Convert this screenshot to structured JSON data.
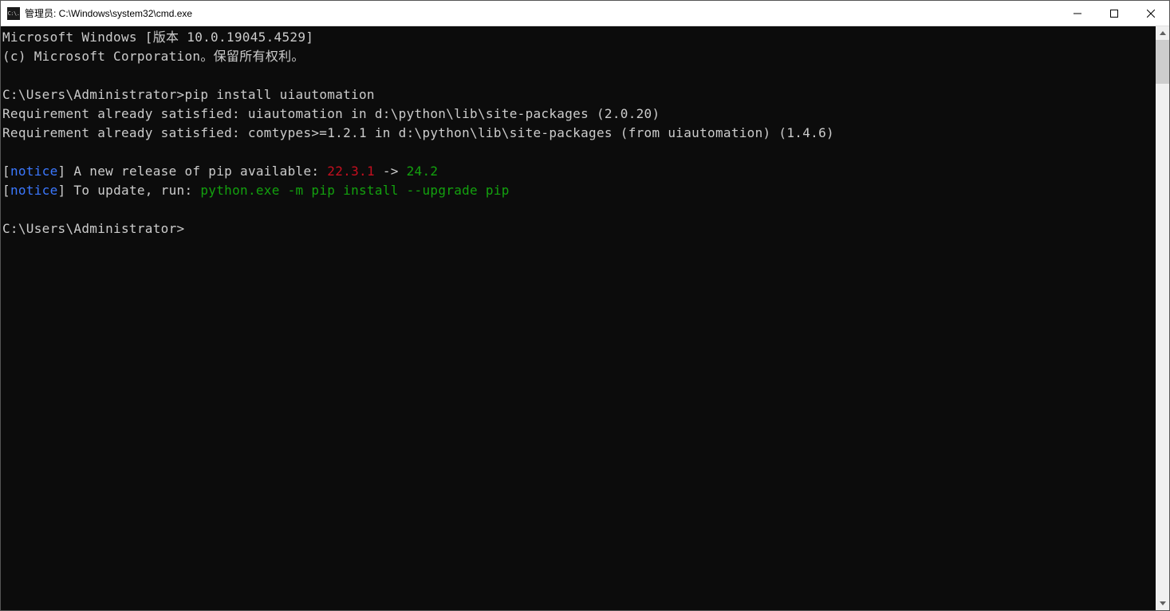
{
  "window": {
    "title": "管理员: C:\\Windows\\system32\\cmd.exe",
    "icon_text": "C:\\."
  },
  "terminal": {
    "header_line1": "Microsoft Windows [版本 10.0.19045.4529]",
    "header_line2": "(c) Microsoft Corporation。保留所有权利。",
    "prompt1_path": "C:\\Users\\Administrator>",
    "prompt1_command": "pip install uiautomation",
    "req1": "Requirement already satisfied: uiautomation in d:\\python\\lib\\site-packages (2.0.20)",
    "req2": "Requirement already satisfied: comtypes>=1.2.1 in d:\\python\\lib\\site-packages (from uiautomation) (1.4.6)",
    "notice1_bracket_open": "[",
    "notice1_word": "notice",
    "notice1_bracket_close": "]",
    "notice1_text": " A new release of pip available: ",
    "notice1_old_version": "22.3.1",
    "notice1_arrow": " -> ",
    "notice1_new_version": "24.2",
    "notice2_bracket_open": "[",
    "notice2_word": "notice",
    "notice2_bracket_close": "]",
    "notice2_text": " To update, run: ",
    "notice2_command": "python.exe -m pip install --upgrade pip",
    "prompt2_path": "C:\\Users\\Administrator>"
  }
}
